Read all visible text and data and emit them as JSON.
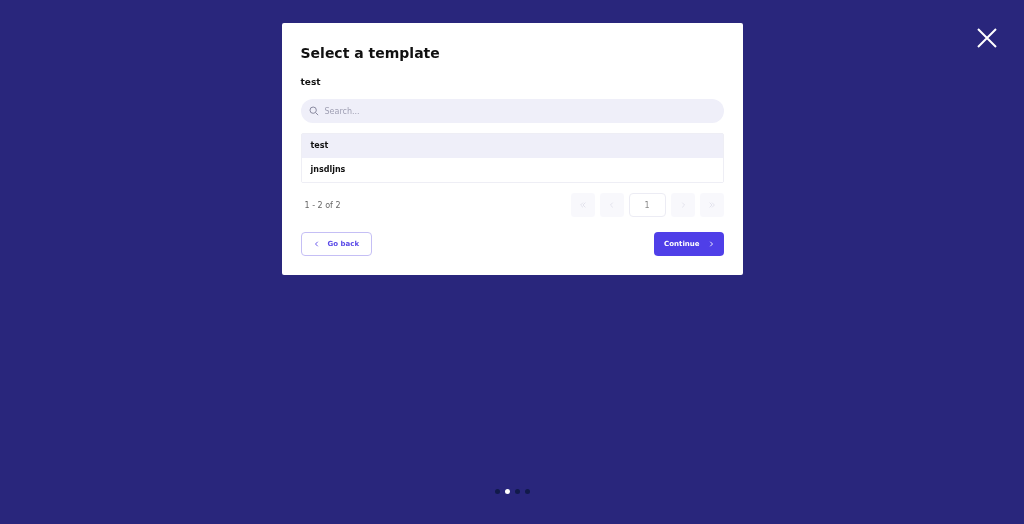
{
  "dialog": {
    "title": "Select a template",
    "subtitle": "test",
    "search": {
      "placeholder": "Search..."
    },
    "items": [
      {
        "label": "test",
        "selected": true
      },
      {
        "label": "jnsdljns",
        "selected": false
      }
    ],
    "range": "1 - 2 of 2",
    "pagination": {
      "page": "1",
      "first_disabled": true,
      "prev_disabled": true,
      "next_disabled": true,
      "last_disabled": true
    },
    "back_button": "Go back",
    "continue_button": "Continue"
  },
  "steps": [
    {
      "selected": false
    },
    {
      "selected": true
    },
    {
      "selected": false
    },
    {
      "selected": false
    }
  ]
}
